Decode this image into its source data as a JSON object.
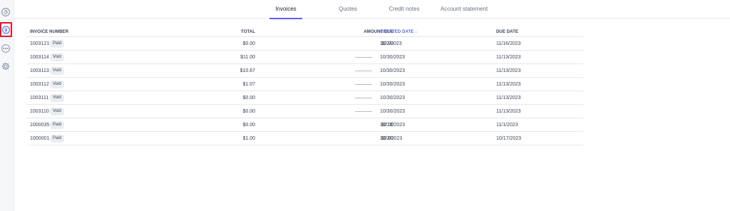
{
  "sidebar": {
    "items": [
      {
        "icon": "refresh-icon"
      },
      {
        "icon": "invoice-icon",
        "active": true
      },
      {
        "icon": "more-icon"
      },
      {
        "icon": "gear-icon"
      }
    ],
    "highlight_color": "#e0182d"
  },
  "tabs": [
    {
      "label": "Invoices",
      "active": true
    },
    {
      "label": "Quotes"
    },
    {
      "label": "Credit notes"
    },
    {
      "label": "Account statement"
    }
  ],
  "table": {
    "columns": {
      "invoice_number": "INVOICE NUMBER",
      "total": "TOTAL",
      "amount_due": "AMOUNT DUE",
      "created_date": "CREATED DATE",
      "due_date": "DUE DATE"
    },
    "sort_indicator": "↓",
    "rows": [
      {
        "number": "1003121",
        "status": "Paid",
        "total": "$0.00",
        "amount_due": "$0.00",
        "created": "11/2/2023",
        "due": "11/16/2023"
      },
      {
        "number": "1003114",
        "status": "Void",
        "total": "$11.00",
        "amount_due": "",
        "created": "10/30/2023",
        "due": "11/13/2023"
      },
      {
        "number": "1003113",
        "status": "Void",
        "total": "$10.67",
        "amount_due": "",
        "created": "10/30/2023",
        "due": "11/13/2023"
      },
      {
        "number": "1003112",
        "status": "Void",
        "total": "$1.07",
        "amount_due": "",
        "created": "10/30/2023",
        "due": "11/13/2023"
      },
      {
        "number": "1003111",
        "status": "Void",
        "total": "$0.00",
        "amount_due": "",
        "created": "10/30/2023",
        "due": "11/13/2023"
      },
      {
        "number": "1003110",
        "status": "Void",
        "total": "$0.00",
        "amount_due": "",
        "created": "10/30/2023",
        "due": "11/13/2023"
      },
      {
        "number": "1000035",
        "status": "Paid",
        "total": "$0.00",
        "amount_due": "$0.00",
        "created": "10/18/2023",
        "due": "11/1/2023"
      },
      {
        "number": "1000001",
        "status": "Paid",
        "total": "$1.00",
        "amount_due": "$0.00",
        "created": "10/3/2023",
        "due": "10/17/2023"
      }
    ]
  },
  "accent_color": "#635bff"
}
